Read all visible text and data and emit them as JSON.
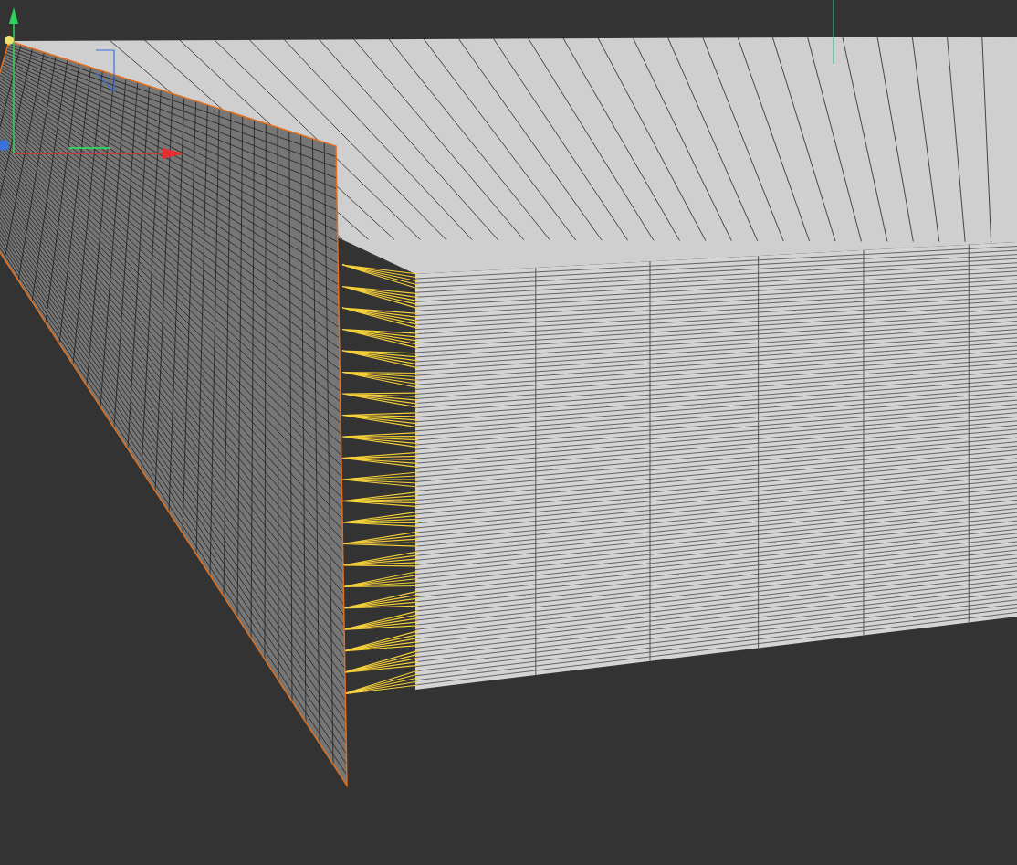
{
  "viewport": {
    "plane": {
      "selected": true
    }
  }
}
